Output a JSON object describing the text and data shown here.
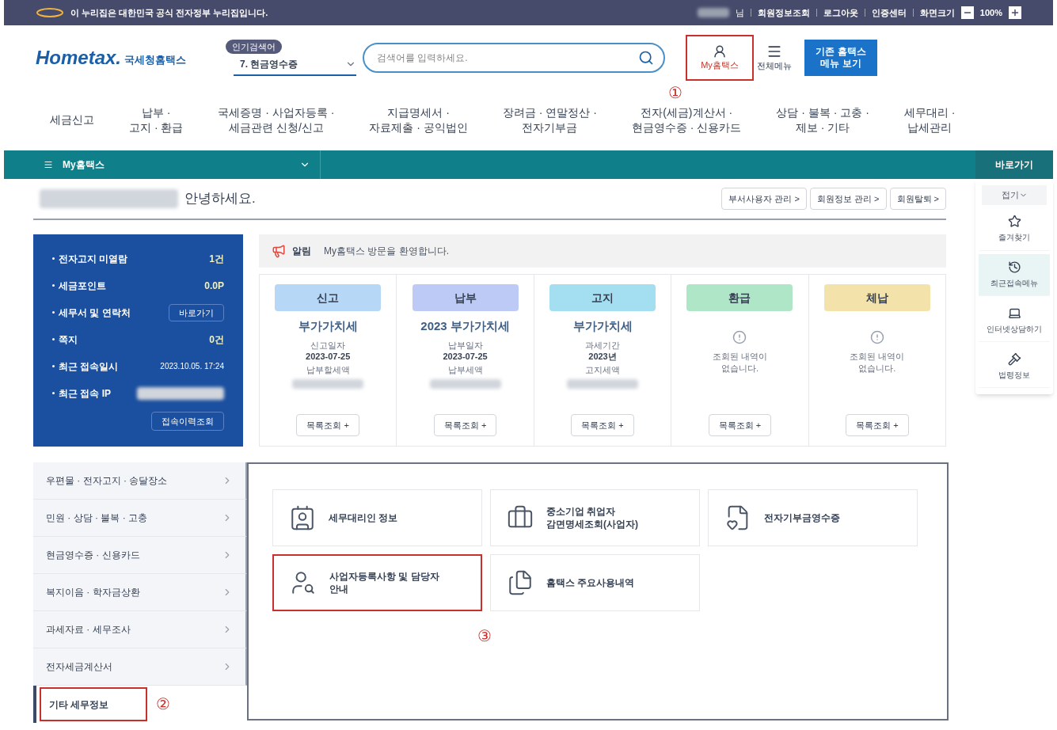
{
  "top_bar": {
    "notice": "이 누리집은 대한민국 공식 전자정부 누리집입니다.",
    "user_suffix": "님",
    "links": [
      "회원정보조회",
      "로그아웃",
      "인증센터"
    ],
    "zoom_label": "화면크기",
    "zoom_value": "100%"
  },
  "header": {
    "logo_text": "Hometax.",
    "logo_sub": "국세청홈택스",
    "popular_badge": "인기검색어",
    "popular_item": "7. 현금영수증",
    "search_placeholder": "검색어를 입력하세요.",
    "my_button": {
      "label": "My홈택스",
      "highlighted": true,
      "marker": "①"
    },
    "all_menu": "전체메뉴",
    "legacy_button": [
      "기존 홈택스",
      "메뉴 보기"
    ]
  },
  "nav": [
    {
      "lines": [
        "세금신고"
      ]
    },
    {
      "lines": [
        "납부 ·",
        "고지 · 환급"
      ]
    },
    {
      "lines": [
        "국세증명 · 사업자등록 ·",
        "세금관련 신청/신고"
      ]
    },
    {
      "lines": [
        "지급명세서 ·",
        "자료제출 · 공익법인"
      ]
    },
    {
      "lines": [
        "장려금 · 연말정산 ·",
        "전자기부금"
      ]
    },
    {
      "lines": [
        "전자(세금)계산서 ·",
        "현금영수증 · 신용카드"
      ]
    },
    {
      "lines": [
        "상담 · 불복 · 고충 ·",
        "제보 · 기타"
      ]
    },
    {
      "lines": [
        "세무대리 ·",
        "납세관리"
      ]
    }
  ],
  "section_bar": {
    "title": "My홈택스"
  },
  "quick": {
    "title": "바로가기",
    "collapse": "접기",
    "items": [
      {
        "label": "즐겨찾기",
        "kind": "star",
        "selected": false
      },
      {
        "label": "최근접속메뉴",
        "kind": "recent",
        "selected": true
      },
      {
        "label": "인터넷상담하기",
        "kind": "laptop",
        "selected": false
      },
      {
        "label": "법령정보",
        "kind": "gavel",
        "selected": false
      }
    ]
  },
  "greeting": "안녕하세요.",
  "account_buttons": [
    "부서사용자 관리 >",
    "회원정보 관리 >",
    "회원탈퇴 >"
  ],
  "summary": [
    {
      "kind": "value",
      "label": "전자고지 미열람",
      "value": "1건"
    },
    {
      "kind": "value",
      "label": "세금포인트",
      "value": "0.0P"
    },
    {
      "kind": "button",
      "label": "세무서 및 연락처",
      "button": "바로가기"
    },
    {
      "kind": "value",
      "label": "쪽지",
      "value": "0건"
    },
    {
      "kind": "small",
      "label": "최근 접속일시",
      "value": "2023.10.05.  17:24"
    },
    {
      "kind": "redacted",
      "label": "최근 접속 IP"
    }
  ],
  "summary_button": "접속이력조회",
  "notice": {
    "label": "알림",
    "text": "My홈택스 방문을 환영합니다."
  },
  "cards": [
    {
      "kind": "data",
      "tag": "신고",
      "color": "#b7d7f7",
      "title": "부가가치세",
      "sub_label": "신고일자",
      "sub_value": "2023-07-25",
      "extra_label": "납부할세액",
      "button": "목록조회 +"
    },
    {
      "kind": "data",
      "tag": "납부",
      "color": "#bccaf5",
      "title": "2023 부가가치세",
      "sub_label": "납부일자",
      "sub_value": "2023-07-25",
      "extra_label": "납부세액",
      "button": "목록조회 +"
    },
    {
      "kind": "data",
      "tag": "고지",
      "color": "#a3dff0",
      "title": "부가가치세",
      "sub_label": "과세기간",
      "sub_value": "2023년",
      "extra_label": "고지세액",
      "button": "목록조회 +"
    },
    {
      "kind": "empty",
      "tag": "환급",
      "color": "#b0e6c8",
      "message": [
        "조회된 내역이",
        "없습니다."
      ],
      "button": "목록조회 +"
    },
    {
      "kind": "empty",
      "tag": "체납",
      "color": "#f3e2a9",
      "message": [
        "조회된 내역이",
        "없습니다."
      ],
      "button": "목록조회 +"
    }
  ],
  "side_menu": [
    {
      "label": "우편물 · 전자고지 · 송달장소",
      "selected": false,
      "highlighted": false
    },
    {
      "label": "민원 · 상담 · 불복 · 고충",
      "selected": false,
      "highlighted": false
    },
    {
      "label": "현금영수증 · 신용카드",
      "selected": false,
      "highlighted": false
    },
    {
      "label": "복지이음 · 학자금상환",
      "selected": false,
      "highlighted": false
    },
    {
      "label": "과세자료 · 세무조사",
      "selected": false,
      "highlighted": false
    },
    {
      "label": "전자세금계산서",
      "selected": false,
      "highlighted": false
    },
    {
      "label": "기타 세무정보",
      "selected": true,
      "highlighted": true,
      "marker": "②"
    }
  ],
  "tiles": [
    {
      "kind": "card",
      "lines": [
        "세무대리인 정보"
      ],
      "highlighted": false
    },
    {
      "kind": "briefcase",
      "lines": [
        "중소기업 취업자",
        "감면명세조회(사업자)"
      ],
      "highlighted": false
    },
    {
      "kind": "donation",
      "lines": [
        "전자기부금영수증"
      ],
      "highlighted": false
    },
    {
      "kind": "person",
      "lines": [
        "사업자등록사항 및 담당자",
        "안내"
      ],
      "highlighted": true,
      "marker": "③"
    },
    {
      "kind": "files",
      "lines": [
        "홈택스 주요사용내역"
      ],
      "highlighted": false
    }
  ]
}
